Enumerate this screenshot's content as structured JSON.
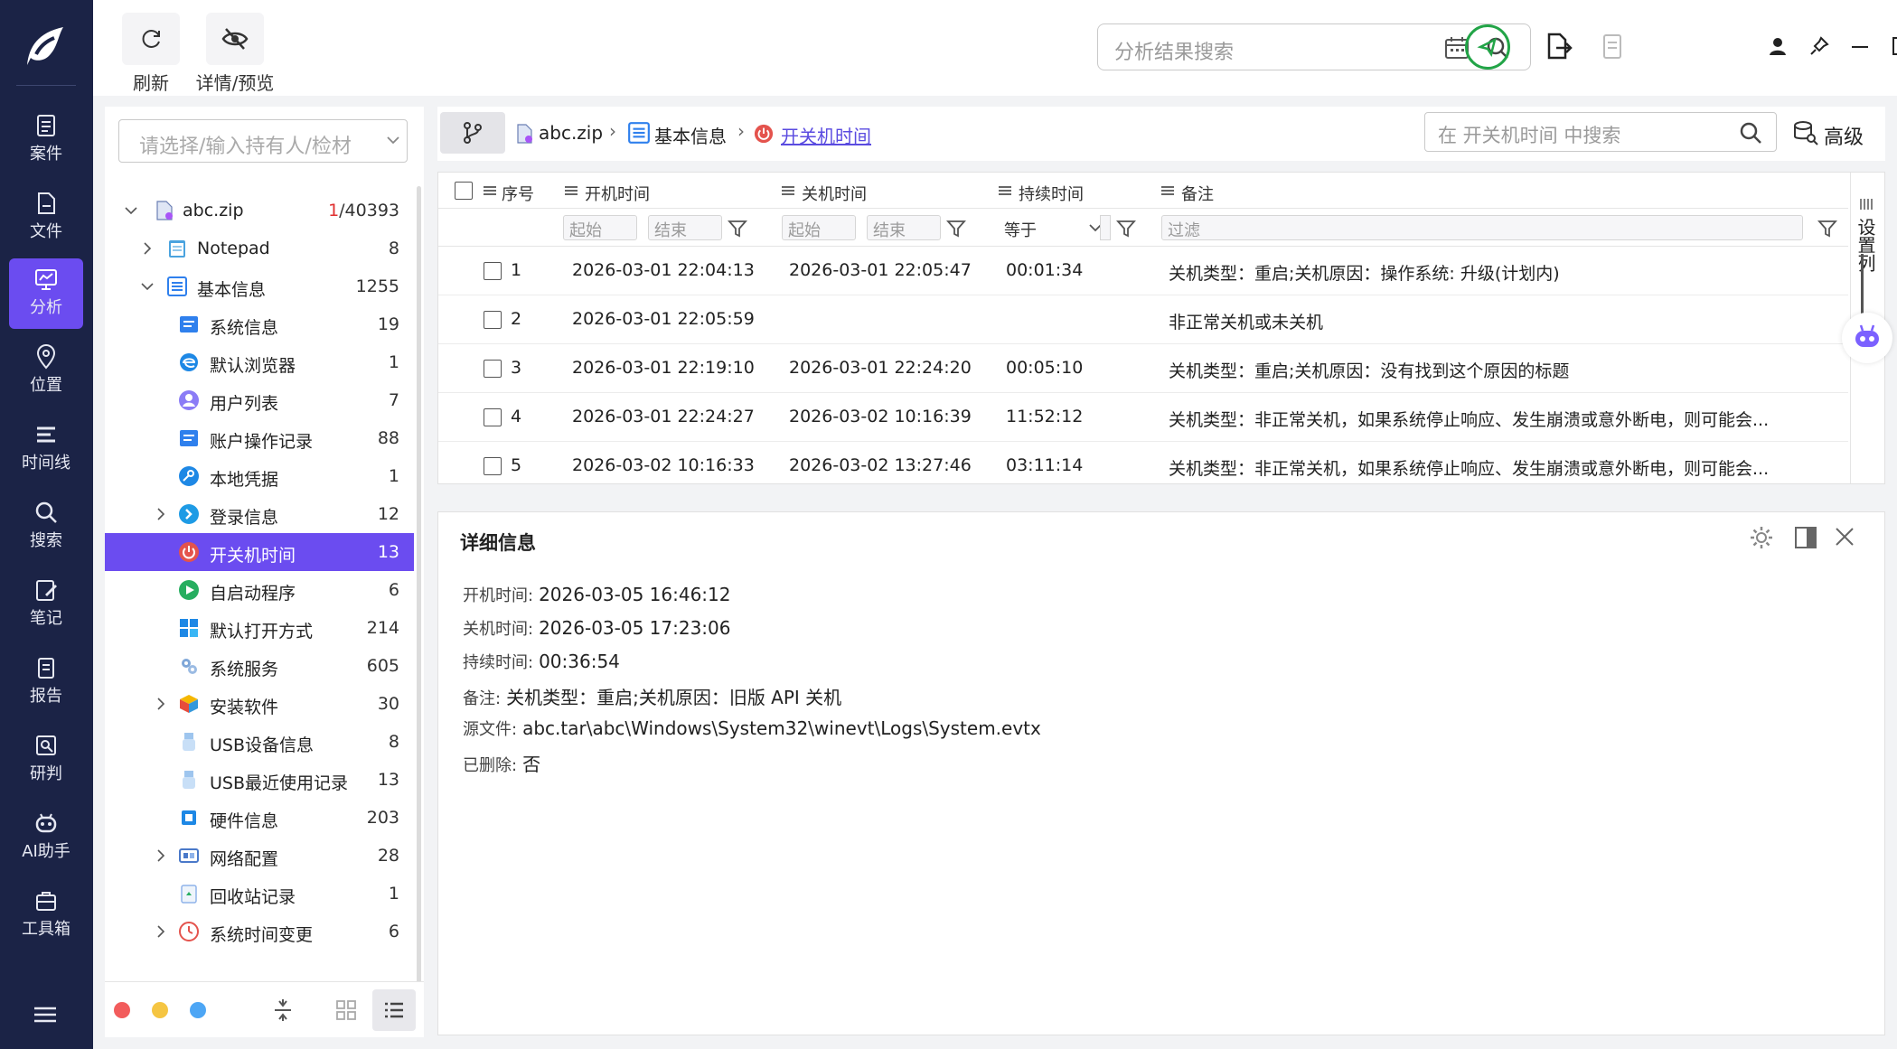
{
  "toolbar": {
    "refresh_label": "刷新",
    "detail_preview_label": "详情/预览",
    "search_placeholder": "分析结果搜索"
  },
  "nav": {
    "items": [
      {
        "label": "案件",
        "icon": "case-icon"
      },
      {
        "label": "文件",
        "icon": "file-icon"
      },
      {
        "label": "分析",
        "icon": "analysis-icon",
        "active": true
      },
      {
        "label": "位置",
        "icon": "location-icon"
      },
      {
        "label": "时间线",
        "icon": "timeline-icon"
      },
      {
        "label": "搜索",
        "icon": "search-icon"
      },
      {
        "label": "笔记",
        "icon": "note-icon"
      },
      {
        "label": "报告",
        "icon": "report-icon"
      },
      {
        "label": "研判",
        "icon": "judge-icon"
      },
      {
        "label": "AI助手",
        "icon": "ai-assistant-icon"
      },
      {
        "label": "工具箱",
        "icon": "toolbox-icon"
      }
    ]
  },
  "tree": {
    "owner_placeholder": "请选择/输入持有人/检材",
    "root": {
      "label": "abc.zip",
      "count_red": "1",
      "count_rest": "/40393"
    },
    "items": [
      {
        "label": "Notepad",
        "count": "8"
      },
      {
        "label": "基本信息",
        "count": "1255"
      },
      {
        "label": "系统信息",
        "count": "19"
      },
      {
        "label": "默认浏览器",
        "count": "1"
      },
      {
        "label": "用户列表",
        "count": "7"
      },
      {
        "label": "账户操作记录",
        "count": "88"
      },
      {
        "label": "本地凭据",
        "count": "1"
      },
      {
        "label": "登录信息",
        "count": "12"
      },
      {
        "label": "开关机时间",
        "count": "13"
      },
      {
        "label": "自启动程序",
        "count": "6"
      },
      {
        "label": "默认打开方式",
        "count": "214"
      },
      {
        "label": "系统服务",
        "count": "605"
      },
      {
        "label": "安装软件",
        "count": "30"
      },
      {
        "label": "USB设备信息",
        "count": "8"
      },
      {
        "label": "USB最近使用记录",
        "count": "13"
      },
      {
        "label": "硬件信息",
        "count": "203"
      },
      {
        "label": "网络配置",
        "count": "28"
      },
      {
        "label": "回收站记录",
        "count": "1"
      },
      {
        "label": "系统时间变更",
        "count": "6"
      }
    ]
  },
  "breadcrumb": {
    "items": [
      "abc.zip",
      "基本信息",
      "开关机时间"
    ],
    "search_placeholder": "在 开关机时间 中搜索",
    "advanced_label": "高级"
  },
  "grid": {
    "columns": [
      "序号",
      "开机时间",
      "关机时间",
      "持续时间",
      "备注"
    ],
    "filters": {
      "start": "起始",
      "end": "结束",
      "equals": "等于",
      "filter": "过滤"
    },
    "settings_label": "设置列",
    "rows": [
      {
        "no": "1",
        "start": "2026-03-01 22:04:13",
        "end": "2026-03-01 22:05:47",
        "duration": "00:01:34",
        "note": "关机类型：重启;关机原因：操作系统: 升级(计划内)"
      },
      {
        "no": "2",
        "start": "2026-03-01 22:05:59",
        "end": "",
        "duration": "",
        "note": "非正常关机或未关机"
      },
      {
        "no": "3",
        "start": "2026-03-01 22:19:10",
        "end": "2026-03-01 22:24:20",
        "duration": "00:05:10",
        "note": "关机类型：重启;关机原因：没有找到这个原因的标题"
      },
      {
        "no": "4",
        "start": "2026-03-01 22:24:27",
        "end": "2026-03-02 10:16:39",
        "duration": "11:52:12",
        "note": "关机类型：非正常关机，如果系统停止响应、发生崩溃或意外断电，则可能会..."
      },
      {
        "no": "5",
        "start": "2026-03-02 10:16:33",
        "end": "2026-03-02 13:27:46",
        "duration": "03:11:14",
        "note": "关机类型：非正常关机，如果系统停止响应、发生崩溃或意外断电，则可能会..."
      }
    ]
  },
  "detail": {
    "title": "详细信息",
    "start_label": "开机时间:",
    "start_value": "2026-03-05 16:46:12",
    "end_label": "关机时间:",
    "end_value": "2026-03-05 17:23:06",
    "duration_label": "持续时间:",
    "duration_value": "00:36:54",
    "note_label": "备注:",
    "note_value": "关机类型：重启;关机原因：旧版 API 关机",
    "source_label": "源文件:",
    "source_value": "abc.tar\\abc\\Windows\\System32\\winevt\\Logs\\System.evtx",
    "deleted_label": "已删除:",
    "deleted_value": "否"
  },
  "colors": {
    "nav_bg": "#1b2346",
    "accent": "#6b4cf0",
    "link": "#5a4be0",
    "green": "#22a447"
  }
}
